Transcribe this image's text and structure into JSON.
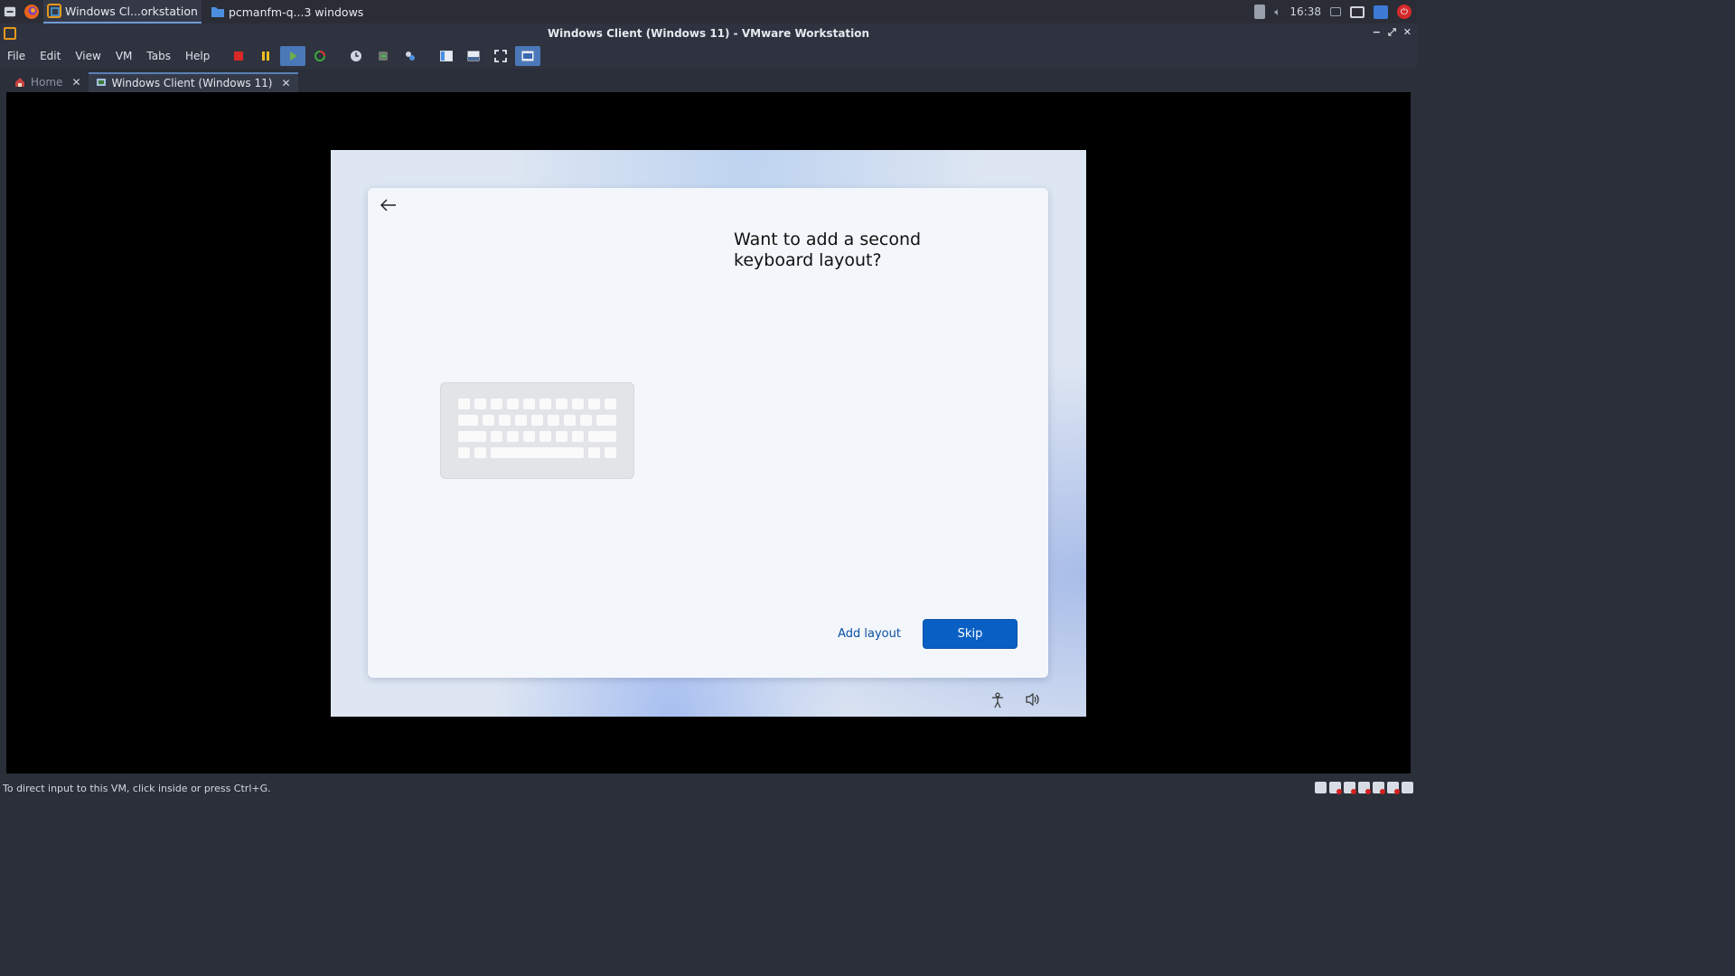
{
  "taskbar": {
    "apps": [
      {
        "label": "Windows Cl...orkstation",
        "active": true
      },
      {
        "label": "pcmanfm-q...3 windows",
        "active": false
      }
    ],
    "clock": "16:38"
  },
  "window": {
    "title": "Windows Client (Windows 11) - VMware Workstation"
  },
  "menu": [
    "File",
    "Edit",
    "View",
    "VM",
    "Tabs",
    "Help"
  ],
  "tabs": [
    {
      "label": "Home",
      "active": false
    },
    {
      "label": "Windows Client (Windows 11)",
      "active": true
    }
  ],
  "guest": {
    "heading": "Want to add a second keyboard layout?",
    "add_layout_label": "Add layout",
    "skip_label": "Skip"
  },
  "status": {
    "message": "To direct input to this VM, click inside or press Ctrl+G."
  },
  "colors": {
    "accent": "#0a5fc4",
    "link": "#0a4fa3",
    "taskbar_bg": "#2a2d36"
  }
}
